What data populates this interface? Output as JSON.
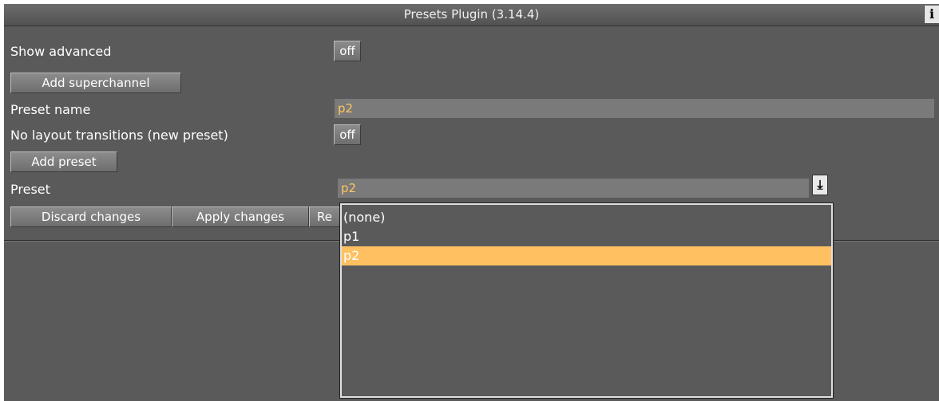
{
  "window": {
    "title": "Presets Plugin (3.14.4)",
    "info_label": "i"
  },
  "show_advanced": {
    "label": "Show advanced",
    "value": "off"
  },
  "add_superchannel_label": "Add superchannel",
  "preset_name": {
    "label": "Preset name",
    "value": "p2"
  },
  "no_layout_transitions": {
    "label": "No layout transitions (new preset)",
    "value": "off"
  },
  "add_preset_label": "Add preset",
  "preset": {
    "label": "Preset",
    "value": "p2",
    "arrow_icon": "down-arrow-icon",
    "options": [
      {
        "label": "(none)",
        "selected": false
      },
      {
        "label": "p1",
        "selected": false
      },
      {
        "label": "p2",
        "selected": true
      }
    ]
  },
  "actions": {
    "discard_label": "Discard changes",
    "apply_label": "Apply changes",
    "third_label_partial": "Re"
  },
  "colors": {
    "accent": "#ffc061",
    "value_text": "#ffc55e",
    "panel": "#5a5a5a"
  }
}
